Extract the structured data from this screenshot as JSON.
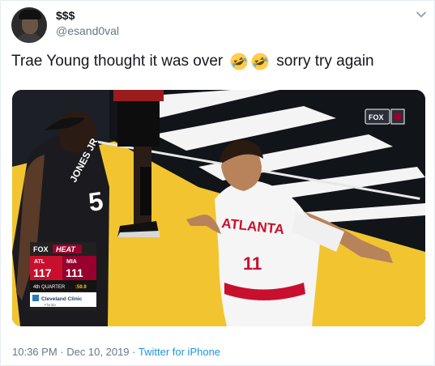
{
  "tweet": {
    "display_name": "$$$",
    "handle": "@esand0val",
    "text_before_emoji": "Trae Young thought it was over",
    "text_after_emoji": "sorry try again",
    "emoji": [
      "rolling-on-floor-laughing",
      "rolling-on-floor-laughing"
    ],
    "timestamp": "10:36 PM · Dec 10, 2019 ·",
    "source": "Twitter for iPhone"
  },
  "media": {
    "network_bug": "FOX",
    "scorebug": {
      "network": "FOX",
      "team_brand": "HEAT",
      "away_team": "ATL",
      "home_team": "MIA",
      "away_score": "117",
      "home_score": "111",
      "quarter": "4th QUARTER",
      "clock": ":59.9",
      "sponsor": "Cleveland Clinic",
      "sponsor_sub": "Florida"
    },
    "left_player_jersey_name": "JONES JR",
    "left_player_number": "5",
    "right_player_jersey_team": "ATLANTA",
    "right_player_number": "11"
  },
  "colors": {
    "link": "#1b95e0",
    "heat_red": "#98002e",
    "hawks_red": "#c8102e",
    "court_yellow": "#f2c530"
  }
}
